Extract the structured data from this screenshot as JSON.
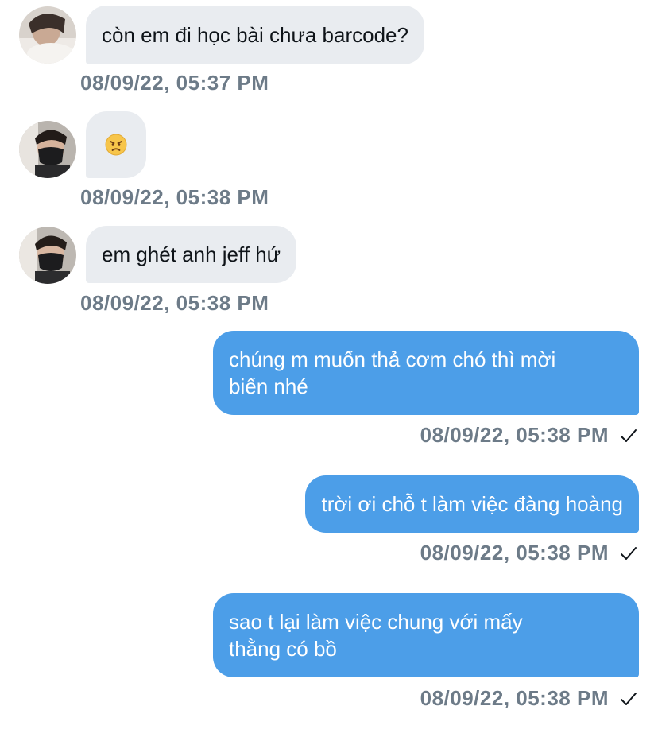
{
  "messages": [
    {
      "direction": "incoming",
      "text": "còn em đi học bài chưa barcode?",
      "timestamp": "08/09/22, 05:37 PM"
    },
    {
      "direction": "incoming",
      "text": "",
      "emoji": "angry-face-emoji",
      "timestamp": "08/09/22, 05:38 PM"
    },
    {
      "direction": "incoming",
      "text": "em ghét anh jeff hứ",
      "timestamp": "08/09/22, 05:38 PM"
    },
    {
      "direction": "outgoing",
      "line1": "chúng m muốn thả cơm chó thì mời",
      "line2": "biến nhé",
      "timestamp": "08/09/22, 05:38 PM",
      "status_icon": "check-icon"
    },
    {
      "direction": "outgoing",
      "text": "trời ơi chỗ t làm việc đàng hoàng",
      "timestamp": "08/09/22, 05:38 PM",
      "status_icon": "check-icon"
    },
    {
      "direction": "outgoing",
      "line1": "sao t lại làm việc chung với mấy",
      "line2": "thằng có bồ",
      "timestamp": "08/09/22, 05:38 PM",
      "status_icon": "check-icon"
    }
  ],
  "colors": {
    "incoming_bubble": "#e9ecf0",
    "outgoing_bubble": "#4c9ee8",
    "timestamp": "#6d7b88",
    "text": "#0f1419"
  }
}
